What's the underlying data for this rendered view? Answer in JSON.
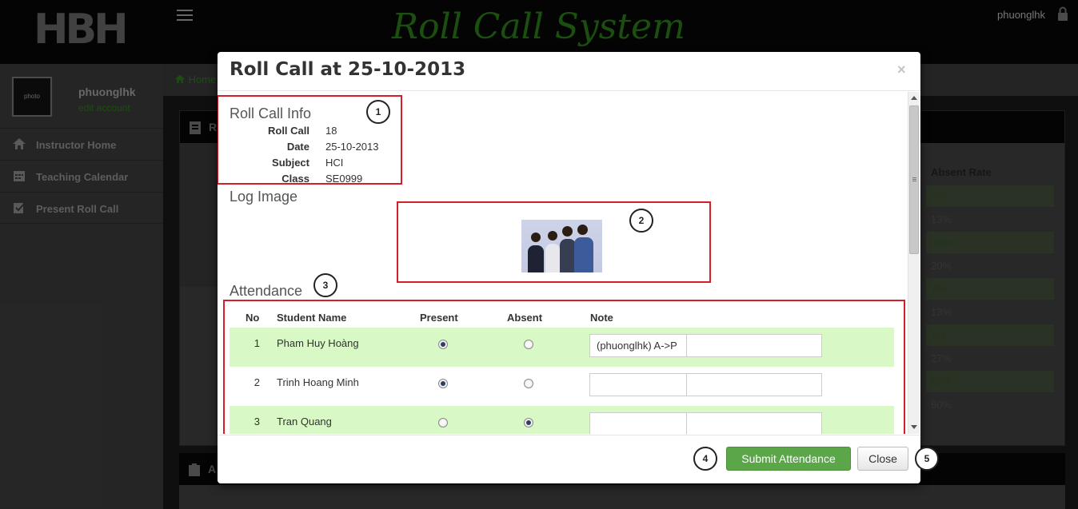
{
  "app": {
    "logo_text": "HBH",
    "title": "Roll Call System",
    "top_user": "phuonglhk"
  },
  "profile": {
    "avatar_text": "photo",
    "name": "phuonglhk",
    "edit_link": "edit account"
  },
  "sidebar": {
    "items": [
      {
        "label": "Instructor Home",
        "icon": "home-icon"
      },
      {
        "label": "Teaching Calendar",
        "icon": "calendar-icon"
      },
      {
        "label": "Present Roll Call",
        "icon": "checkbox-icon"
      }
    ]
  },
  "breadcrumb": {
    "home": "Home"
  },
  "background_panel": {
    "heading_letter": "R",
    "rate_header": "Absent Rate",
    "rates": [
      "7%",
      "13%",
      "40%",
      "20%",
      "7%",
      "13%",
      "7%",
      "27%",
      "60%",
      "60%"
    ],
    "second_heading_letter": "A"
  },
  "modal": {
    "title": "Roll Call at 25-10-2013",
    "close_symbol": "×",
    "info_section": {
      "title": "Roll Call Info",
      "fields": [
        {
          "label": "Roll Call",
          "value": "18"
        },
        {
          "label": "Date",
          "value": "25-10-2013"
        },
        {
          "label": "Subject",
          "value": "HCI"
        },
        {
          "label": "Class",
          "value": "SE0999"
        }
      ]
    },
    "log_image_title": "Log Image",
    "attendance": {
      "title": "Attendance",
      "headers": {
        "no": "No",
        "name": "Student Name",
        "present": "Present",
        "absent": "Absent",
        "note": "Note"
      },
      "rows": [
        {
          "no": "1",
          "name": "Pham Huy Hoàng",
          "status": "present",
          "note": "(phuonglhk) A->P"
        },
        {
          "no": "2",
          "name": "Trinh Hoang Minh",
          "status": "present",
          "note": ""
        },
        {
          "no": "3",
          "name": "Tran Quang",
          "status": "absent",
          "note": ""
        }
      ]
    },
    "buttons": {
      "submit": "Submit Attendance",
      "close": "Close"
    }
  },
  "callouts": [
    "1",
    "2",
    "3",
    "4",
    "5"
  ],
  "colors": {
    "present_row": "#d8f8c5",
    "submit_button": "#5aa648",
    "callout_box": "#d2202a"
  }
}
